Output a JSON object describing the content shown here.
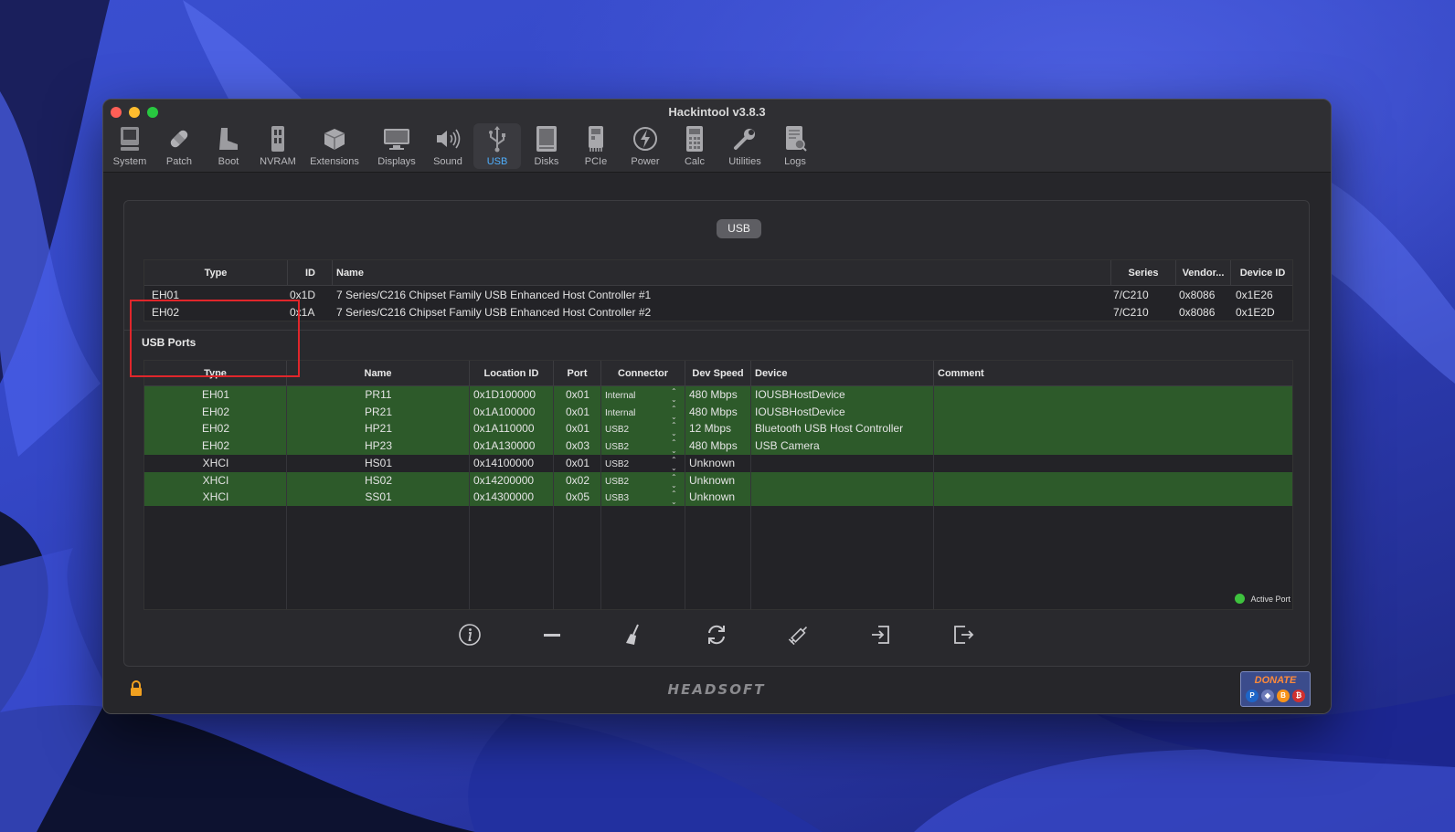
{
  "window": {
    "title": "Hackintool v3.8.3"
  },
  "toolbar": [
    {
      "label": "System",
      "icon": "system-icon"
    },
    {
      "label": "Patch",
      "icon": "patch-icon"
    },
    {
      "label": "Boot",
      "icon": "boot-icon"
    },
    {
      "label": "NVRAM",
      "icon": "nvram-icon"
    },
    {
      "label": "Extensions",
      "icon": "extensions-icon"
    },
    {
      "label": "Displays",
      "icon": "displays-icon"
    },
    {
      "label": "Sound",
      "icon": "sound-icon"
    },
    {
      "label": "USB",
      "icon": "usb-icon",
      "active": true
    },
    {
      "label": "Disks",
      "icon": "disks-icon"
    },
    {
      "label": "PCIe",
      "icon": "pcie-icon"
    },
    {
      "label": "Power",
      "icon": "power-icon"
    },
    {
      "label": "Calc",
      "icon": "calc-icon"
    },
    {
      "label": "Utilities",
      "icon": "utilities-icon"
    },
    {
      "label": "Logs",
      "icon": "logs-icon"
    }
  ],
  "segment": "USB",
  "controllers": {
    "headers": [
      "Type",
      "ID",
      "Name",
      "Series",
      "Vendor...",
      "Device ID"
    ],
    "rows": [
      {
        "type": "EH01",
        "id": "0x1D",
        "name": "7 Series/C216 Chipset Family USB Enhanced Host Controller #1",
        "series": "7/C210",
        "vendor": "0x8086",
        "device_id": "0x1E26"
      },
      {
        "type": "EH02",
        "id": "0x1A",
        "name": "7 Series/C216 Chipset Family USB Enhanced Host Controller #2",
        "series": "7/C210",
        "vendor": "0x8086",
        "device_id": "0x1E2D"
      }
    ]
  },
  "ports": {
    "title": "USB Ports",
    "headers": [
      "Type",
      "Name",
      "Location ID",
      "Port",
      "Connector",
      "Dev Speed",
      "Device",
      "Comment"
    ],
    "rows": [
      {
        "type": "EH01",
        "name": "PR11",
        "location": "0x1D100000",
        "port": "0x01",
        "connector": "Internal",
        "speed": "480 Mbps",
        "device": "IOUSBHostDevice",
        "comment": "",
        "active": true
      },
      {
        "type": "EH02",
        "name": "PR21",
        "location": "0x1A100000",
        "port": "0x01",
        "connector": "Internal",
        "speed": "480 Mbps",
        "device": "IOUSBHostDevice",
        "comment": "",
        "active": true
      },
      {
        "type": "EH02",
        "name": "HP21",
        "location": "0x1A110000",
        "port": "0x01",
        "connector": "USB2",
        "speed": "12 Mbps",
        "device": "Bluetooth USB Host Controller",
        "comment": "",
        "active": true
      },
      {
        "type": "EH02",
        "name": "HP23",
        "location": "0x1A130000",
        "port": "0x03",
        "connector": "USB2",
        "speed": "480 Mbps",
        "device": "USB Camera",
        "comment": "",
        "active": true
      },
      {
        "type": "XHCI",
        "name": "HS01",
        "location": "0x14100000",
        "port": "0x01",
        "connector": "USB2",
        "speed": "Unknown",
        "device": "",
        "comment": "",
        "active": false
      },
      {
        "type": "XHCI",
        "name": "HS02",
        "location": "0x14200000",
        "port": "0x02",
        "connector": "USB2",
        "speed": "Unknown",
        "device": "",
        "comment": "",
        "active": true
      },
      {
        "type": "XHCI",
        "name": "SS01",
        "location": "0x14300000",
        "port": "0x05",
        "connector": "USB3",
        "speed": "Unknown",
        "device": "",
        "comment": "",
        "active": true
      }
    ]
  },
  "legend": {
    "label": "Active Port",
    "color": "#3ec23e"
  },
  "actions": [
    {
      "name": "info-icon"
    },
    {
      "name": "remove-icon"
    },
    {
      "name": "clear-broom-icon"
    },
    {
      "name": "refresh-icon"
    },
    {
      "name": "inject-syringe-icon"
    },
    {
      "name": "import-icon"
    },
    {
      "name": "export-icon"
    }
  ],
  "footer": {
    "brand": "HEADSOFT",
    "donate": "DONATE"
  },
  "colors": {
    "active_row": "#2d5a2a",
    "accent": "#4fb0ff",
    "highlight": "#e0262b"
  }
}
